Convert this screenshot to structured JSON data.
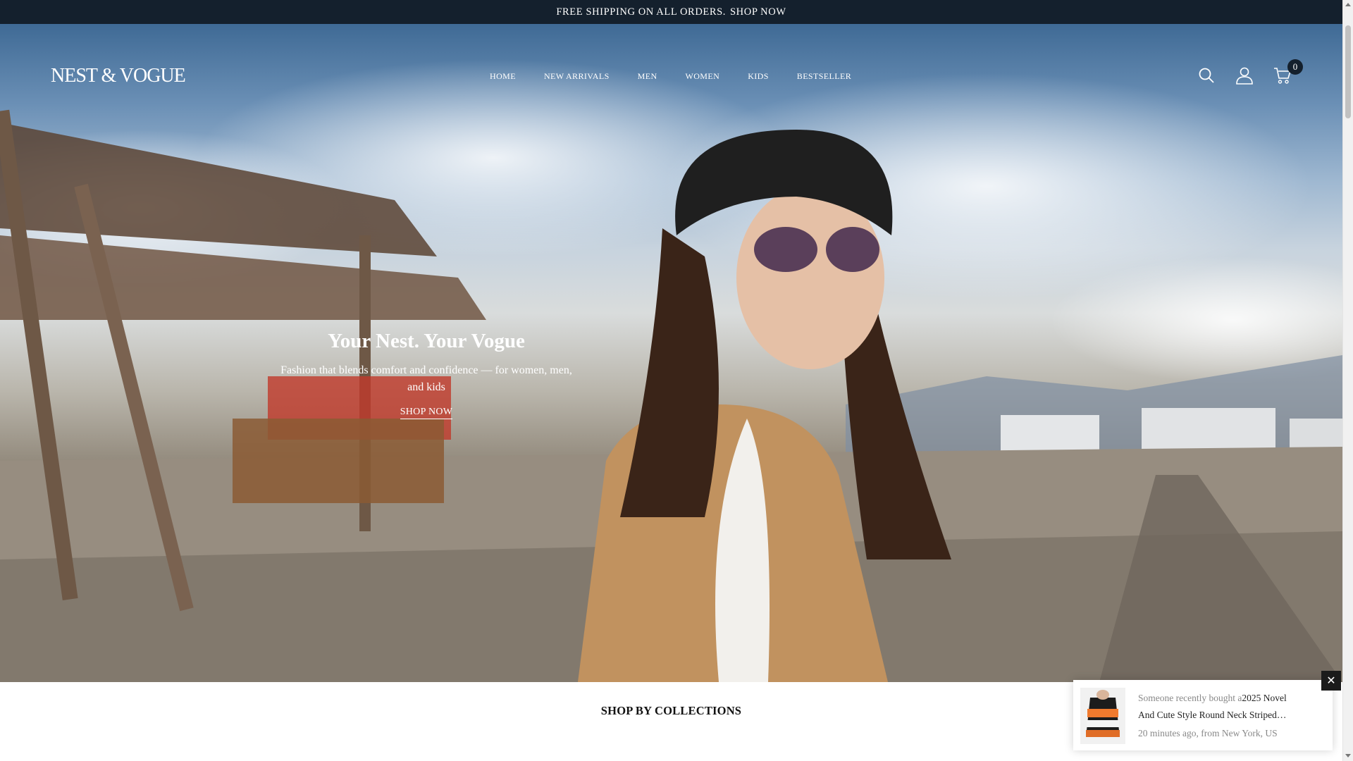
{
  "announcement": {
    "message": "FREE SHIPPING ON ALL ORDERS.",
    "link": "SHOP NOW"
  },
  "header": {
    "logo": "NEST & VOGUE",
    "nav": [
      "HOME",
      "NEW ARRIVALS",
      "MEN",
      "WOMEN",
      "KIDS",
      "BESTSELLER"
    ],
    "icons": [
      "search-icon",
      "account-icon",
      "cart-icon"
    ],
    "cart_count": "0"
  },
  "hero": {
    "title": "Your Nest. Your Vogue",
    "subtitle": "Fashion that blends comfort and confidence — for women, men, and kids",
    "cta": "SHOP NOW"
  },
  "section": {
    "title": "SHOP BY COLLECTIONS"
  },
  "popup": {
    "prefix": "Someone recently bought a",
    "product": "2025 Novel And Cute Style Round Neck Striped…",
    "meta": "20 minutes ago, from New York, US",
    "close_icon": "close-icon"
  },
  "colors": {
    "announcement_bg": "#14202d",
    "close_bg": "#1b1b1b"
  }
}
